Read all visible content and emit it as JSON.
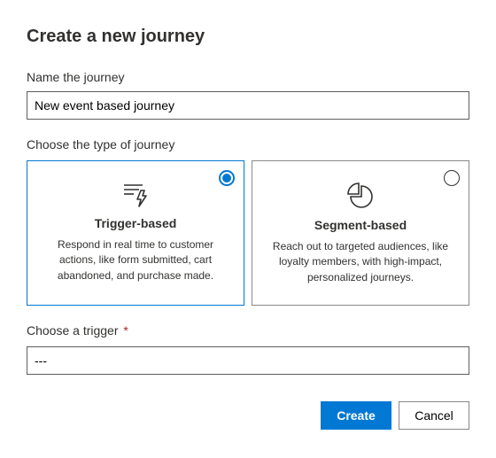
{
  "page_title": "Create a new journey",
  "name_field": {
    "label": "Name the journey",
    "value": "New event based journey"
  },
  "type_section_label": "Choose the type of journey",
  "journey_types": {
    "trigger": {
      "title": "Trigger-based",
      "desc": "Respond in real time to customer actions, like form submitted, cart abandoned, and purchase made.",
      "selected": true
    },
    "segment": {
      "title": "Segment-based",
      "desc": "Reach out to targeted audiences, like loyalty members, with high-impact, personalized journeys.",
      "selected": false
    }
  },
  "trigger_field": {
    "label": "Choose a trigger",
    "required_mark": "*",
    "value": "---"
  },
  "buttons": {
    "create": "Create",
    "cancel": "Cancel"
  }
}
